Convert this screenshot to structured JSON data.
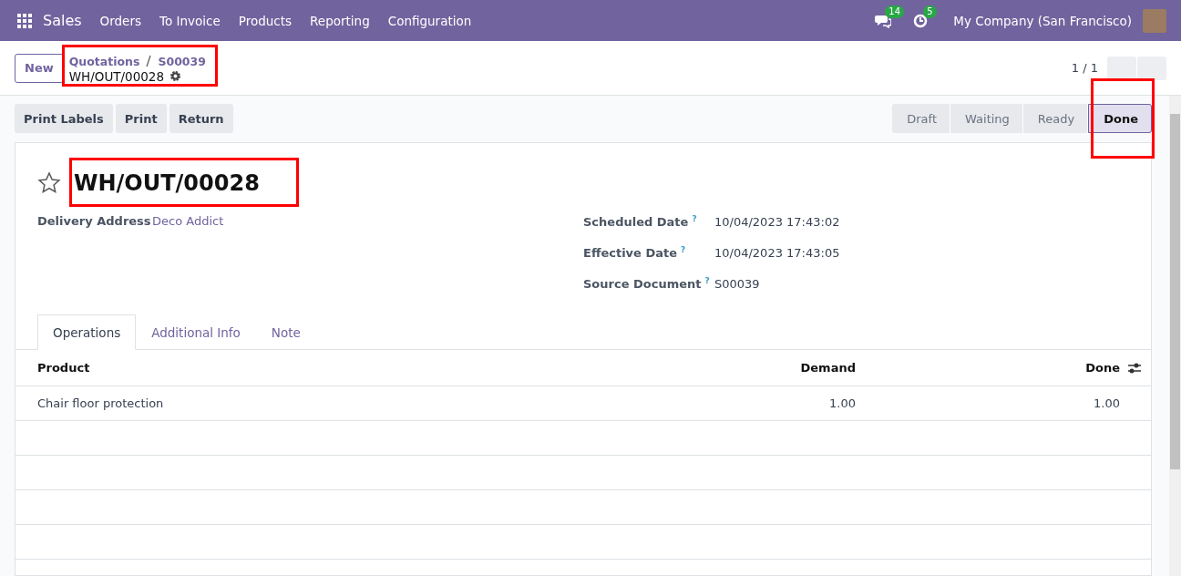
{
  "navbar": {
    "app": "Sales",
    "menus": [
      "Orders",
      "To Invoice",
      "Products",
      "Reporting",
      "Configuration"
    ],
    "messages_count": "14",
    "activities_count": "5",
    "company": "My Company (San Francisco)"
  },
  "control_panel": {
    "new_button": "New",
    "breadcrumbs": [
      "Quotations",
      "S00039"
    ],
    "current": "WH/OUT/00028",
    "pager": "1 / 1"
  },
  "actions": [
    "Print Labels",
    "Print",
    "Return"
  ],
  "stages": [
    {
      "label": "Draft",
      "selected": false
    },
    {
      "label": "Waiting",
      "selected": false
    },
    {
      "label": "Ready",
      "selected": false
    },
    {
      "label": "Done",
      "selected": true
    }
  ],
  "record": {
    "title": "WH/OUT/00028",
    "starred": false,
    "left_fields": [
      {
        "label": "Delivery Address",
        "value": "Deco Addict"
      }
    ],
    "right_fields": [
      {
        "label": "Scheduled Date",
        "help": "?",
        "value": "10/04/2023 17:43:02"
      },
      {
        "label": "Effective Date",
        "help": "?",
        "value": "10/04/2023 17:43:05"
      },
      {
        "label": "Source Document",
        "help": "?",
        "value": "S00039"
      }
    ]
  },
  "tabs": [
    {
      "label": "Operations",
      "selected": true
    },
    {
      "label": "Additional Info",
      "selected": false
    },
    {
      "label": "Note",
      "selected": false
    }
  ],
  "table": {
    "columns": [
      "Product",
      "Demand",
      "Done"
    ],
    "rows": [
      [
        "Chair floor protection",
        "1.00",
        "1.00"
      ]
    ]
  }
}
